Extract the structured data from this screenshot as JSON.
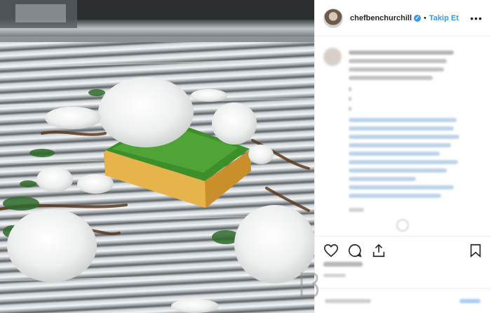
{
  "post": {
    "username": "chefbenchurchill",
    "verified_mark": "✓",
    "separator": "•",
    "follow_label": "Takip Et",
    "more_label": "•••"
  },
  "photo": {
    "subject": "sponge-dish-on-sink-drain"
  },
  "icons": {
    "like": "heart-icon",
    "comment": "comment-icon",
    "share": "share-icon",
    "save": "bookmark-icon"
  },
  "colors": {
    "accent": "#3897f0",
    "text": "#262626",
    "border": "#efefef"
  }
}
